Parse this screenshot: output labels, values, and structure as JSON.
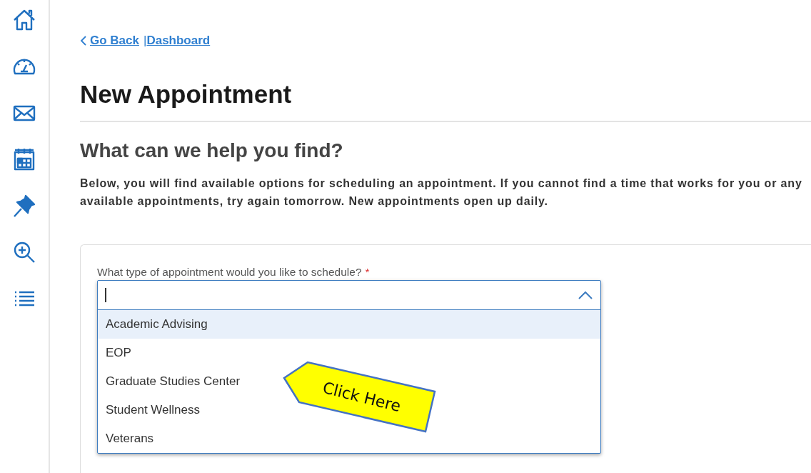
{
  "breadcrumb": {
    "back": "Go Back",
    "separator": "|",
    "link": "Dashboard"
  },
  "page_title": "New Appointment",
  "section_title": "What can we help you find?",
  "intro_lines": [
    "Below, you will find available options for scheduling an appointment. If you cannot find a time that works for you or any",
    "available appointments, try again tomorrow. New appointments open up daily."
  ],
  "appointment_type": {
    "label": "What type of appointment would you like to schedule?",
    "required_mark": "*",
    "expanded": true,
    "options": [
      {
        "label": "Academic Advising",
        "selected": true
      },
      {
        "label": "EOP",
        "selected": false
      },
      {
        "label": "Graduate Studies Center",
        "selected": false
      },
      {
        "label": "Student Wellness",
        "selected": false
      },
      {
        "label": "Veterans",
        "selected": false
      }
    ]
  },
  "callout": {
    "text": "Click Here"
  }
}
